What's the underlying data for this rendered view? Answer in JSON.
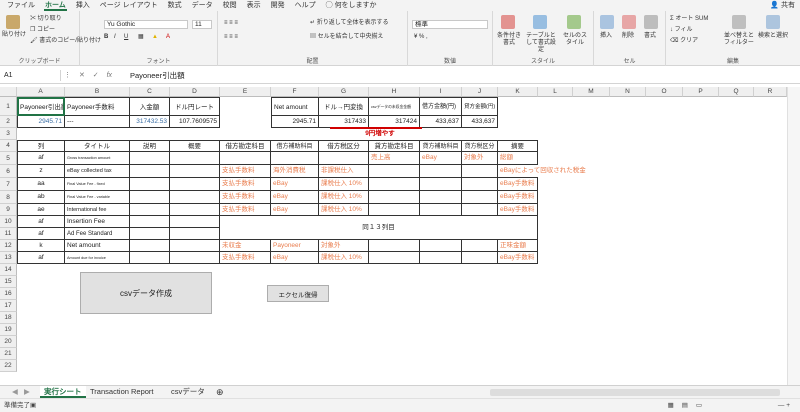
{
  "ribbon_tabs": [
    "ファイル",
    "ホーム",
    "挿入",
    "ページ レイアウト",
    "数式",
    "データ",
    "校閲",
    "表示",
    "開発",
    "ヘルプ",
    "何をしますか"
  ],
  "share_label": "共有",
  "clipboard": {
    "paste": "貼り付け",
    "cut": "切り取り",
    "copy": "コピー",
    "format_painter": "書式のコピー/貼り付け",
    "label": "クリップボード"
  },
  "font": {
    "name": "Yu Gothic",
    "size": "11",
    "label": "フォント"
  },
  "alignment": {
    "wrap": "折り返して全体を表示する",
    "merge": "セルを結合して中央揃え",
    "label": "配置"
  },
  "number": {
    "format": "標準",
    "label": "数値"
  },
  "styles": {
    "conditional": "条件付き書式",
    "table": "テーブルとして書式設定",
    "cell": "セルのスタイル",
    "label": "スタイル"
  },
  "cells": {
    "insert": "挿入",
    "delete": "削除",
    "format": "書式",
    "label": "セル"
  },
  "editing": {
    "autosum": "オート SUM",
    "fill": "フィル",
    "clear": "クリア",
    "sort": "並べ替えとフィルター",
    "find": "検索と選択",
    "label": "編集"
  },
  "name_box": "A1",
  "fx": "fx",
  "formula_value": "Payoneer引出額",
  "columns": [
    "A",
    "B",
    "C",
    "D",
    "E",
    "F",
    "G",
    "H",
    "I",
    "J",
    "K",
    "L",
    "M",
    "N",
    "O",
    "P",
    "Q",
    "R"
  ],
  "rows": [
    "1",
    "2",
    "3",
    "4",
    "5",
    "6",
    "7",
    "8",
    "9",
    "10",
    "11",
    "12",
    "13",
    "14",
    "15",
    "16",
    "17",
    "18",
    "19",
    "20",
    "21",
    "22"
  ],
  "r1": {
    "a": "Payoneer引出額",
    "b": "Payoneer手数料",
    "c": "入金額",
    "d": "ドル円レート",
    "f": "Net amount",
    "g": "ドル→円変換",
    "h": "csvデータの未収金金額",
    "i": "借方金額(円)",
    "j": "貸方金額(円)"
  },
  "r2": {
    "a": "2945.71",
    "b": "---",
    "c": "317432.53",
    "d": "107.7609575",
    "f": "2945.71",
    "g": "317433",
    "h": "317424",
    "i": "433,637",
    "j": "433,637"
  },
  "note_h3": "9円増やす",
  "r4": {
    "a": "列",
    "b": "タイトル",
    "c": "説明",
    "d": "概要",
    "e": "借方勘定科目",
    "f": "借方補助科目",
    "g": "借方税区分",
    "h": "貸方勘定科目",
    "i": "貸方補助科目",
    "j": "貸方税区分",
    "k": "摘要"
  },
  "r5": {
    "a": "af",
    "b": "Gross transaction amount",
    "h": "売上高",
    "i": "eBay",
    "j": "対象外",
    "k": "総額"
  },
  "r6": {
    "a": "z",
    "b": "eBay collected tax",
    "e": "支払手数料",
    "f": "海外消費税",
    "g": "非課税仕入",
    "k": "eBayによって回収された税金"
  },
  "r7": {
    "a": "aa",
    "b": "Final Value Fee - fixed",
    "e": "支払手数料",
    "f": "eBay",
    "g": "課税仕入 10%",
    "k": "eBay手数料"
  },
  "r8": {
    "a": "ab",
    "b": "Final Value Fee - variable",
    "e": "支払手数料",
    "f": "eBay",
    "g": "課税仕入 10%",
    "k": "eBay手数料"
  },
  "r9": {
    "a": "ae",
    "b": "International fee",
    "e": "支払手数料",
    "f": "eBay",
    "g": "課税仕入 10%",
    "k": "eBay手数料"
  },
  "r10": {
    "a": "af",
    "b": "Insertion Fee"
  },
  "r11": {
    "a": "af",
    "b": "Ad Fee Standard"
  },
  "merged_note": "同１３列目",
  "r12": {
    "a": "k",
    "b": "Net amount",
    "e": "未収金",
    "f": "Payoneer",
    "g": "対象外",
    "k": "正味金額"
  },
  "r13": {
    "a": "af",
    "b": "Amount due for invoice",
    "e": "支払手数料",
    "f": "eBay",
    "g": "課税仕入 10%",
    "k": "eBay手数料"
  },
  "buttons": {
    "csv": "csvデータ作成",
    "reset": "エクセル復帰"
  },
  "sheets": [
    "実行シート",
    "Transaction Report",
    "csvデータ"
  ],
  "status": "準備完了"
}
